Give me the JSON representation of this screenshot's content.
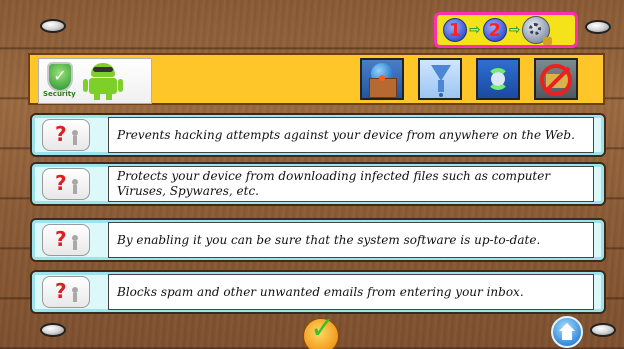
{
  "header": {
    "logo_label": "Security",
    "step_indicator": {
      "steps": [
        "1",
        "2"
      ],
      "final_icon": "settings-lock-icon"
    },
    "feature_icons": [
      {
        "name": "web-protection-icon"
      },
      {
        "name": "download-filter-icon"
      },
      {
        "name": "system-update-icon"
      },
      {
        "name": "spam-block-icon"
      }
    ]
  },
  "rows": [
    {
      "text": "Prevents hacking attempts against your device from anywhere on the Web."
    },
    {
      "text": "Protects your device from downloading infected files such as computer Viruses, Spywares, etc."
    },
    {
      "text": "By enabling it you can be sure that the system software is up-to-date."
    },
    {
      "text": "Blocks spam and other unwanted emails from entering your inbox."
    }
  ],
  "bottom": {
    "confirm_icon": "checkmark-icon",
    "home_icon": "home-icon"
  },
  "colors": {
    "header_bg": "#ffc62a",
    "step_panel_bg": "#f4e21a",
    "step_panel_border": "#ff2fb0",
    "row_bg": "#ddf8f8",
    "wood": "#8c5b35"
  }
}
